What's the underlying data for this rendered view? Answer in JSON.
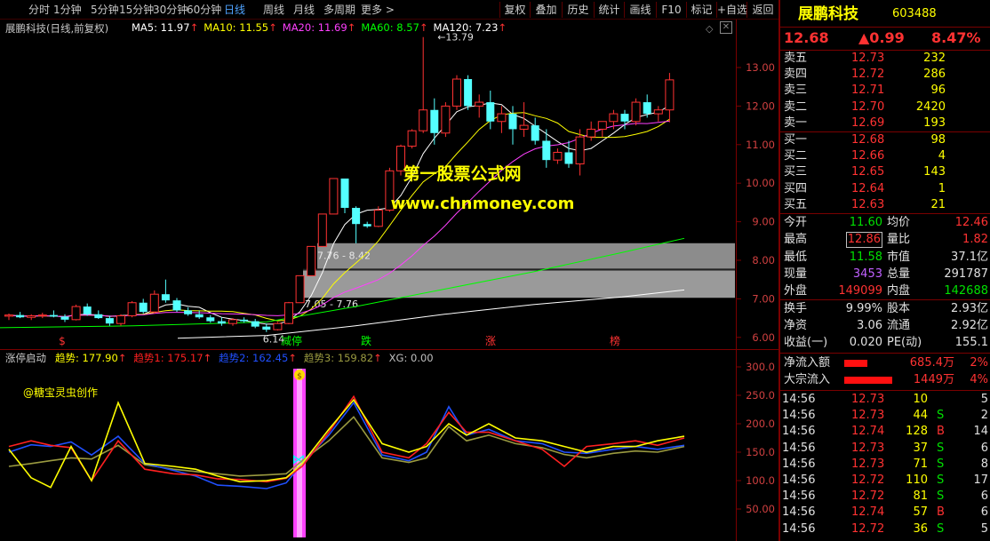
{
  "toolbar": {
    "periods": [
      "分时",
      "1分钟",
      "5分钟",
      "15分钟",
      "30分钟",
      "60分钟",
      "日线",
      "周线",
      "月线",
      "多周期",
      "更多 >"
    ],
    "active_period": "日线",
    "buttons": [
      "复权",
      "叠加",
      "历史",
      "统计",
      "画线",
      "F10",
      "标记",
      "+自选",
      "返回"
    ]
  },
  "main_chart": {
    "stock_label": "展鹏科技(日线,前复权)",
    "ma": [
      {
        "name": "MA5",
        "value": "11.97",
        "arrow": "↑",
        "color": "#ffffff"
      },
      {
        "name": "MA10",
        "value": "11.55",
        "arrow": "↑",
        "color": "#ffff00"
      },
      {
        "name": "MA20",
        "value": "11.69",
        "arrow": "↑",
        "color": "#ff40ff"
      },
      {
        "name": "MA60",
        "value": "8.57",
        "arrow": "↑",
        "color": "#00ff00"
      },
      {
        "name": "MA120",
        "value": "7.23",
        "arrow": "↑",
        "color": "#ffffff"
      }
    ],
    "y_ticks": [
      "13.00",
      "12.00",
      "11.00",
      "10.00",
      "9.00",
      "8.00",
      "7.00",
      "6.00"
    ],
    "high_label": "13.79",
    "low_label": "6.14",
    "zone_labels": [
      "7.76 - 8.42",
      "7.05 - 7.76"
    ],
    "signals": [
      {
        "text": "$",
        "color": "#ff3232"
      },
      {
        "text": "减停",
        "color": "#00ff00"
      },
      {
        "text": "跌",
        "color": "#00ff00"
      },
      {
        "text": "涨",
        "color": "#ff3232"
      },
      {
        "text": "榜",
        "color": "#ff3232"
      }
    ],
    "watermark_1": "第一股票公式网",
    "watermark_2": "www.chnmoney.com",
    "candles": [
      [
        6.55,
        6.62,
        6.45,
        6.58
      ],
      [
        6.58,
        6.66,
        6.5,
        6.52
      ],
      [
        6.52,
        6.6,
        6.45,
        6.56
      ],
      [
        6.56,
        6.64,
        6.5,
        6.58
      ],
      [
        6.58,
        6.7,
        6.52,
        6.54
      ],
      [
        6.54,
        6.6,
        6.4,
        6.46
      ],
      [
        6.46,
        6.85,
        6.44,
        6.8
      ],
      [
        6.8,
        6.88,
        6.56,
        6.6
      ],
      [
        6.6,
        6.7,
        6.48,
        6.5
      ],
      [
        6.5,
        6.56,
        6.3,
        6.36
      ],
      [
        6.36,
        6.6,
        6.3,
        6.56
      ],
      [
        6.56,
        6.94,
        6.52,
        6.9
      ],
      [
        6.9,
        7.0,
        6.62,
        6.66
      ],
      [
        6.66,
        7.22,
        6.62,
        7.12
      ],
      [
        7.12,
        7.5,
        6.9,
        6.96
      ],
      [
        6.96,
        7.02,
        6.66,
        6.7
      ],
      [
        6.7,
        6.78,
        6.56,
        6.6
      ],
      [
        6.6,
        6.7,
        6.48,
        6.52
      ],
      [
        6.52,
        6.58,
        6.38,
        6.42
      ],
      [
        6.42,
        6.52,
        6.3,
        6.36
      ],
      [
        6.36,
        6.5,
        6.3,
        6.46
      ],
      [
        6.46,
        6.52,
        6.38,
        6.42
      ],
      [
        6.42,
        6.48,
        6.24,
        6.28
      ],
      [
        6.28,
        6.36,
        6.14,
        6.2
      ],
      [
        6.2,
        6.4,
        6.18,
        6.36
      ],
      [
        6.36,
        6.92,
        6.34,
        6.9
      ],
      [
        6.9,
        7.6,
        6.9,
        7.6
      ],
      [
        7.6,
        8.36,
        7.6,
        8.36
      ],
      [
        8.36,
        9.2,
        8.36,
        9.2
      ],
      [
        9.2,
        10.12,
        9.2,
        10.12
      ],
      [
        10.12,
        10.12,
        9.22,
        9.36
      ],
      [
        9.36,
        9.4,
        8.44,
        8.94
      ],
      [
        8.94,
        9.0,
        8.84,
        8.88
      ],
      [
        8.88,
        9.4,
        8.86,
        9.3
      ],
      [
        9.3,
        10.4,
        9.26,
        10.32
      ],
      [
        10.32,
        11.0,
        10.2,
        10.96
      ],
      [
        10.96,
        11.4,
        10.9,
        11.36
      ],
      [
        11.36,
        13.79,
        11.3,
        11.9
      ],
      [
        11.9,
        12.2,
        11.0,
        11.3
      ],
      [
        11.3,
        12.1,
        11.2,
        12.0
      ],
      [
        12.0,
        12.8,
        11.9,
        12.7
      ],
      [
        12.7,
        12.8,
        11.9,
        12.0
      ],
      [
        12.0,
        12.3,
        11.7,
        12.1
      ],
      [
        12.1,
        12.4,
        11.4,
        11.6
      ],
      [
        11.6,
        12.0,
        11.3,
        11.8
      ],
      [
        11.8,
        12.0,
        11.0,
        11.4
      ],
      [
        11.4,
        12.1,
        11.2,
        11.5
      ],
      [
        11.5,
        11.7,
        11.0,
        11.1
      ],
      [
        11.1,
        11.4,
        10.4,
        10.6
      ],
      [
        10.6,
        10.9,
        10.5,
        10.8
      ],
      [
        10.8,
        11.1,
        10.4,
        10.5
      ],
      [
        10.5,
        11.4,
        10.2,
        11.2
      ],
      [
        11.2,
        11.6,
        11.1,
        11.4
      ],
      [
        11.4,
        11.6,
        11.2,
        11.6
      ],
      [
        11.6,
        11.9,
        11.4,
        11.8
      ],
      [
        11.8,
        11.9,
        11.4,
        11.6
      ],
      [
        11.6,
        12.2,
        11.5,
        12.1
      ],
      [
        12.1,
        12.3,
        11.7,
        11.8
      ],
      [
        11.8,
        12.0,
        11.6,
        11.9
      ],
      [
        11.9,
        12.86,
        11.58,
        12.68
      ]
    ]
  },
  "indicator": {
    "name": "涨停启动",
    "lines": [
      {
        "name": "趋势",
        "value": "177.90",
        "arrow": "↑",
        "color": "#ffff00"
      },
      {
        "name": "趋势1",
        "value": "175.17",
        "arrow": "↑",
        "color": "#ff2020"
      },
      {
        "name": "趋势2",
        "value": "162.45",
        "arrow": "↑",
        "color": "#2050ff"
      },
      {
        "name": "趋势3",
        "value": "159.82",
        "arrow": "↑",
        "color": "#9a9a40"
      },
      {
        "name": "XG",
        "value": "0.00",
        "arrow": "",
        "color": "#c0c0c0"
      }
    ],
    "author": "@糖宝灵虫创作",
    "y_ticks": [
      "300.0",
      "250.0",
      "200.0",
      "150.0",
      "100.0",
      "50.00"
    ]
  },
  "quote": {
    "name": "展鹏科技",
    "code": "603488",
    "price": "12.68",
    "change": "▲0.99",
    "change_pct": "8.47%",
    "asks": [
      {
        "label": "卖五",
        "price": "12.73",
        "vol": "232"
      },
      {
        "label": "卖四",
        "price": "12.72",
        "vol": "286"
      },
      {
        "label": "卖三",
        "price": "12.71",
        "vol": "96"
      },
      {
        "label": "卖二",
        "price": "12.70",
        "vol": "2420"
      },
      {
        "label": "卖一",
        "price": "12.69",
        "vol": "193"
      }
    ],
    "bids": [
      {
        "label": "买一",
        "price": "12.68",
        "vol": "98"
      },
      {
        "label": "买二",
        "price": "12.66",
        "vol": "4"
      },
      {
        "label": "买三",
        "price": "12.65",
        "vol": "143"
      },
      {
        "label": "买四",
        "price": "12.64",
        "vol": "1"
      },
      {
        "label": "买五",
        "price": "12.63",
        "vol": "21"
      }
    ],
    "stats": [
      {
        "l1": "今开",
        "v1": "11.60",
        "c1": "green",
        "l2": "均价",
        "v2": "12.46",
        "c2": "red"
      },
      {
        "l1": "最高",
        "v1": "12.86",
        "c1": "red",
        "l2": "量比",
        "v2": "1.82",
        "c2": "red"
      },
      {
        "l1": "最低",
        "v1": "11.58",
        "c1": "green",
        "l2": "市值",
        "v2": "37.1亿",
        "c2": "white"
      },
      {
        "l1": "现量",
        "v1": "3453",
        "c1": "purple",
        "l2": "总量",
        "v2": "291787",
        "c2": "white"
      },
      {
        "l1": "外盘",
        "v1": "149099",
        "c1": "red",
        "l2": "内盘",
        "v2": "142688",
        "c2": "green"
      }
    ],
    "stats2": [
      {
        "l1": "换手",
        "v1": "9.99%",
        "l2": "股本",
        "v2": "2.93亿"
      },
      {
        "l1": "净资",
        "v1": "3.06",
        "l2": "流通",
        "v2": "2.92亿"
      },
      {
        "l1": "收益(一)",
        "v1": "0.020",
        "l2": "PE(动)",
        "v2": "155.1"
      }
    ],
    "flows": [
      {
        "label": "净流入额",
        "amount": "685.4万",
        "pct": "2%"
      },
      {
        "label": "大宗流入",
        "amount": "1449万",
        "pct": "4%"
      }
    ],
    "ticks": [
      {
        "time": "14:56",
        "price": "12.73",
        "vol": "10",
        "side": "",
        "count": "5"
      },
      {
        "time": "14:56",
        "price": "12.73",
        "vol": "44",
        "side": "S",
        "count": "2"
      },
      {
        "time": "14:56",
        "price": "12.74",
        "vol": "128",
        "side": "B",
        "count": "14"
      },
      {
        "time": "14:56",
        "price": "12.73",
        "vol": "37",
        "side": "S",
        "count": "6"
      },
      {
        "time": "14:56",
        "price": "12.73",
        "vol": "71",
        "side": "S",
        "count": "8"
      },
      {
        "time": "14:56",
        "price": "12.72",
        "vol": "110",
        "side": "S",
        "count": "17"
      },
      {
        "time": "14:56",
        "price": "12.72",
        "vol": "81",
        "side": "S",
        "count": "6"
      },
      {
        "time": "14:56",
        "price": "12.74",
        "vol": "57",
        "side": "B",
        "count": "6"
      },
      {
        "time": "14:56",
        "price": "12.72",
        "vol": "36",
        "side": "S",
        "count": "5"
      }
    ]
  }
}
